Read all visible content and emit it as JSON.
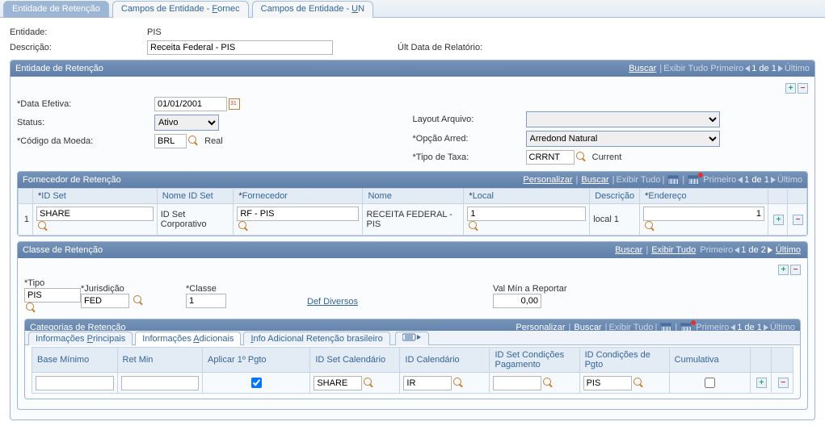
{
  "top_tabs": {
    "t1": "Entidade de Retenção",
    "t2_pre": "Campos de Entidade - ",
    "t2_u": "F",
    "t2_post": "ornec",
    "t3_pre": "Campos de Entidade - ",
    "t3_u": "U",
    "t3_post": "N"
  },
  "header": {
    "entidade_lbl": "Entidade:",
    "entidade": "PIS",
    "descricao_lbl": "Descrição:",
    "descricao": "Receita Federal - PIS",
    "ult_data_lbl": "Últ Data de Relatório:"
  },
  "s1": {
    "title": "Entidade de Retenção",
    "nav": {
      "buscar": "Buscar",
      "exibir": "Exibir Tudo",
      "primeiro": "Primeiro",
      "count": "1 de 1",
      "ultimo": "Último"
    },
    "data_efetiva_lbl": "Data Efetiva:",
    "data_efetiva": "01/01/2001",
    "status_lbl": "Status:",
    "status": "Ativo",
    "codigo_moeda_lbl": "Código da Moeda:",
    "codigo_moeda": "BRL",
    "codigo_moeda_desc": "Real",
    "layout_lbl": "Layout Arquivo:",
    "layout": "",
    "opcao_lbl": "Opção Arred:",
    "opcao": "Arredond Natural",
    "tipo_taxa_lbl": "Tipo de Taxa:",
    "tipo_taxa": "CRRNT",
    "tipo_taxa_desc": "Current"
  },
  "s2": {
    "title": "Fornecedor de Retenção",
    "nav": {
      "personalizar": "Personalizar",
      "buscar": "Buscar",
      "exibir": "Exibir Tudo",
      "primeiro": "Primeiro",
      "count": "1 de 1",
      "ultimo": "Último"
    },
    "cols": {
      "idset": "ID Set",
      "nome_idset": "Nome ID Set",
      "fornecedor": "Fornecedor",
      "nome": "Nome",
      "local": "Local",
      "descricao": "Descrição",
      "endereco": "Endereço"
    },
    "row": {
      "n": "1",
      "idset": "SHARE",
      "nome_idset": "ID Set Corporativo",
      "fornecedor": "RF - PIS",
      "nome": "RECEITA FEDERAL - PIS",
      "local": "1",
      "descricao": "local 1",
      "endereco": "1"
    }
  },
  "s3": {
    "title": "Classe de Retenção",
    "nav": {
      "buscar": "Buscar",
      "exibir": "Exibir Tudo",
      "primeiro": "Primeiro",
      "count": "1 de 2",
      "ultimo": "Último"
    },
    "tipo_lbl": "Tipo",
    "tipo": "PIS",
    "jurisdicao_lbl": "Jurisdição",
    "jurisdicao": "FED",
    "classe_lbl": "Classe",
    "classe": "1",
    "def_diversos": "Def Diversos",
    "val_min_lbl": "Val Mín a Reportar",
    "val_min": "0,00"
  },
  "s4": {
    "title": "Categorias de Retenção",
    "nav": {
      "personalizar": "Personalizar",
      "buscar": "Buscar",
      "exibir": "Exibir Tudo",
      "primeiro": "Primeiro",
      "count": "1 de 1",
      "ultimo": "Último"
    },
    "sub_tabs": {
      "t1_pre": "Informações ",
      "t1_u": "P",
      "t1_post": "rincipais",
      "t2_pre": "Informações ",
      "t2_u": "A",
      "t2_post": "dicionais",
      "t3_pre": "",
      "t3_u": "I",
      "t3_post": "nfo Adicional Retenção brasileiro"
    },
    "cols": {
      "base_min": "Base Mínimo",
      "ret_min": "Ret Min",
      "aplicar": "Aplicar 1º Pgto",
      "idset_cal": "ID Set Calendário",
      "id_cal": "ID Calendário",
      "idset_cond": "ID Set Condições Pagamento",
      "id_cond": "ID Condições de Pgto",
      "cumulativa": "Cumulativa"
    },
    "row": {
      "base_min": "",
      "ret_min": "",
      "aplicar": true,
      "idset_cal": "SHARE",
      "id_cal": "IR",
      "idset_cond": "",
      "id_cond": "PIS",
      "cumulativa": false
    }
  }
}
